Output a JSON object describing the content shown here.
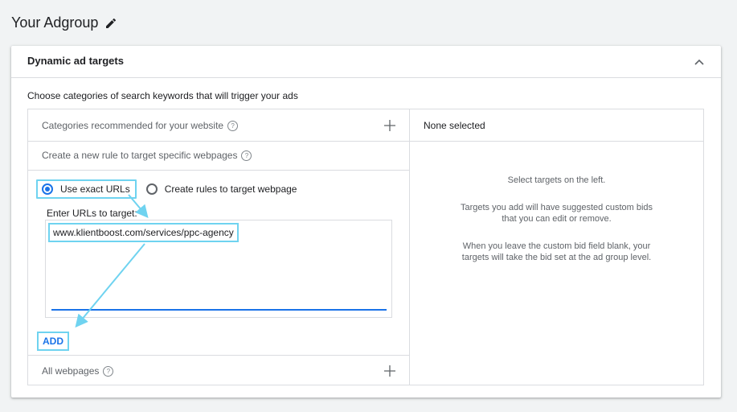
{
  "page": {
    "title": "Your Adgroup"
  },
  "card": {
    "title": "Dynamic ad targets",
    "intro": "Choose categories of search keywords that will trigger your ads"
  },
  "left": {
    "categories_label": "Categories recommended for your website",
    "rule_label": "Create a new rule to target specific webpages",
    "radio_exact": "Use exact URLs",
    "radio_rules": "Create rules to target webpage",
    "url_label": "Enter URLs to target:",
    "url_value": "www.klientboost.com/services/ppc-agency",
    "add_label": "ADD",
    "all_webpages_label": "All webpages"
  },
  "right": {
    "header": "None selected",
    "line1": "Select targets on the left.",
    "line2a": "Targets you add will have suggested custom bids",
    "line2b": "that you can edit or remove.",
    "line3a": "When you leave the custom bid field blank, your",
    "line3b": "targets will take the bid set at the ad group level."
  },
  "colors": {
    "accent": "#1a73e8",
    "highlight": "#6fd3f0"
  },
  "icons": {
    "edit": "pencil-icon",
    "collapse": "chevron-up-icon",
    "help": "help-circle-icon",
    "add": "plus-icon"
  }
}
